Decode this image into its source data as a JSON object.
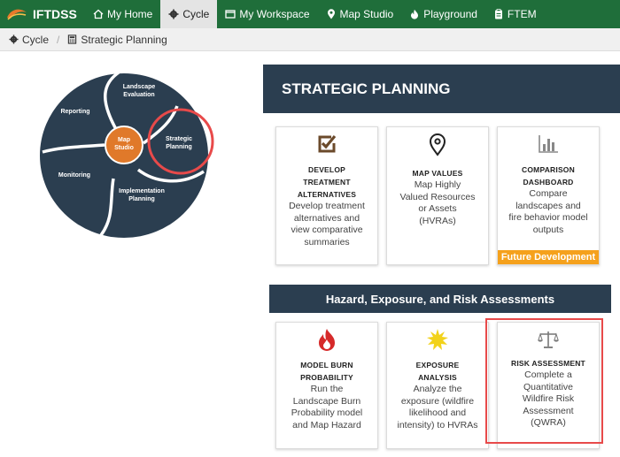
{
  "nav": {
    "brand": "IFTDSS",
    "items": [
      {
        "label": "My Home",
        "icon": "home-icon"
      },
      {
        "label": "Cycle",
        "icon": "cycle-gear-icon",
        "active": true
      },
      {
        "label": "My Workspace",
        "icon": "window-icon"
      },
      {
        "label": "Map Studio",
        "icon": "map-pin-icon"
      },
      {
        "label": "Playground",
        "icon": "flame-icon"
      },
      {
        "label": "FTEM",
        "icon": "clipboard-icon"
      }
    ]
  },
  "breadcrumb": {
    "items": [
      {
        "label": "Cycle",
        "icon": "cycle-gear-icon"
      },
      {
        "label": "Strategic Planning",
        "icon": "calculator-icon"
      }
    ]
  },
  "cycle": {
    "segments": [
      "Landscape Evaluation",
      "Strategic Planning",
      "Implementation Planning",
      "Monitoring",
      "Reporting"
    ],
    "center": "Map Studio",
    "highlighted": "Strategic Planning"
  },
  "strategic": {
    "title": "STRATEGIC PLANNING",
    "cards": [
      {
        "title": "DEVELOP TREATMENT ALTERNATIVES",
        "desc": "Develop treatment alternatives and view comparative summaries",
        "icon": "checkbox-icon"
      },
      {
        "title": "MAP VALUES",
        "desc": "Map Highly Valued Resources or Assets (HVRAs)",
        "icon": "map-marker-icon"
      },
      {
        "title": "COMPARISON DASHBOARD",
        "desc": "Compare landscapes and fire behavior model outputs",
        "icon": "bar-chart-icon",
        "badge": "Future Development"
      }
    ]
  },
  "hazard": {
    "title": "Hazard, Exposure, and Risk Assessments",
    "cards": [
      {
        "title": "MODEL BURN PROBABILITY",
        "desc": "Run the Landscape Burn Probability model and Map Hazard",
        "icon": "fire-icon"
      },
      {
        "title": "EXPOSURE ANALYSIS",
        "desc": "Analyze the exposure (wildfire likelihood and intensity) to HVRAs",
        "icon": "sun-burst-icon"
      },
      {
        "title": "RISK ASSESSMENT",
        "desc": "Complete a Quantitative Wildfire Risk Assessment (QWRA)",
        "icon": "balance-scale-icon"
      }
    ]
  },
  "colors": {
    "nav": "#1f6e3a",
    "header": "#2b3e50",
    "accent_orange": "#f5a11c",
    "highlight_red": "#e84a4a",
    "cycle_orange": "#e0792a"
  }
}
